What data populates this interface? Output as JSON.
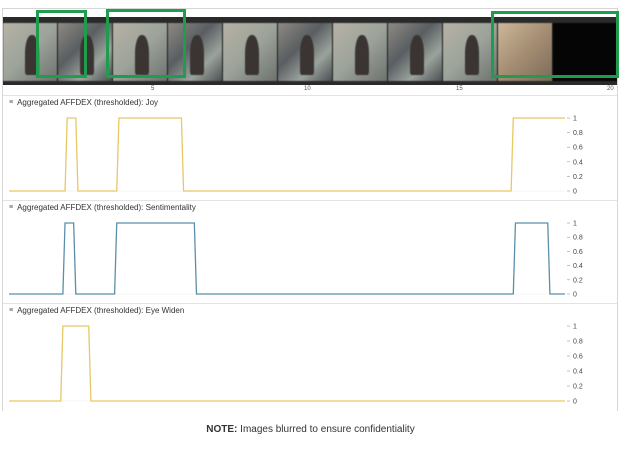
{
  "timeline": {
    "ticks": [
      "5",
      "10",
      "15",
      "20"
    ]
  },
  "panels": [
    {
      "title": "Aggregated AFFDEX (thresholded): Joy",
      "color": "#e8c766",
      "yticks": [
        "1",
        "0.8",
        "0.6",
        "0.4",
        "0.2",
        "0"
      ],
      "points": [
        [
          0,
          0
        ],
        [
          2.6,
          0
        ],
        [
          2.7,
          1
        ],
        [
          3.1,
          1
        ],
        [
          3.2,
          0
        ],
        [
          5.0,
          0
        ],
        [
          5.1,
          1
        ],
        [
          8.0,
          1
        ],
        [
          8.1,
          0
        ],
        [
          23.3,
          0
        ],
        [
          23.4,
          1
        ],
        [
          25.8,
          1
        ]
      ]
    },
    {
      "title": "Aggregated AFFDEX (thresholded): Sentimentality",
      "color": "#5b8fa8",
      "yticks": [
        "1",
        "0.8",
        "0.6",
        "0.4",
        "0.2",
        "0"
      ],
      "points": [
        [
          0,
          0
        ],
        [
          2.5,
          0
        ],
        [
          2.6,
          1
        ],
        [
          3.0,
          1
        ],
        [
          3.1,
          0
        ],
        [
          4.9,
          0
        ],
        [
          5.0,
          1
        ],
        [
          8.6,
          1
        ],
        [
          8.7,
          0
        ],
        [
          23.4,
          0
        ],
        [
          23.5,
          1
        ],
        [
          25.0,
          1
        ],
        [
          25.1,
          0
        ],
        [
          25.8,
          0
        ]
      ]
    },
    {
      "title": "Aggregated AFFDEX (thresholded): Eye Widen",
      "color": "#e8c766",
      "yticks": [
        "1",
        "0.8",
        "0.6",
        "0.4",
        "0.2",
        "0"
      ],
      "points": [
        [
          0,
          0
        ],
        [
          2.4,
          0
        ],
        [
          2.5,
          1
        ],
        [
          3.7,
          1
        ],
        [
          3.8,
          0
        ],
        [
          25.8,
          0
        ]
      ]
    }
  ],
  "note": {
    "label": "NOTE:",
    "text": " Images blurred to ensure confidentiality"
  }
}
